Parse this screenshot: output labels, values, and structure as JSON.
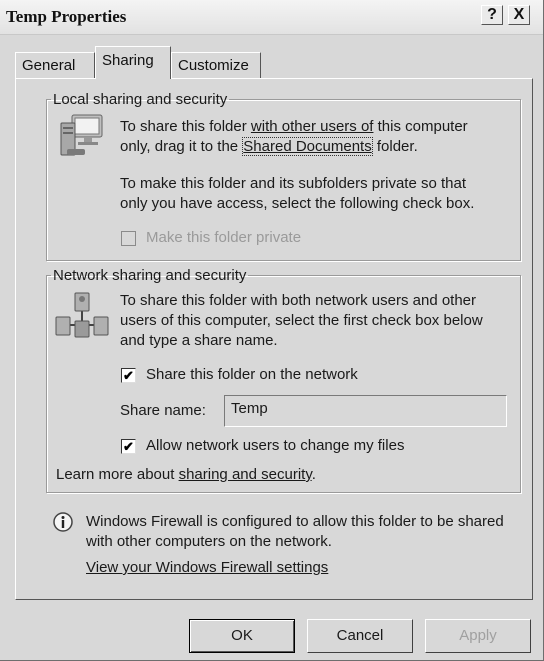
{
  "window": {
    "title": "Temp Properties",
    "help_label": "?",
    "close_label": "X"
  },
  "tabs": [
    {
      "label": "General",
      "active": false
    },
    {
      "label": "Sharing",
      "active": true
    },
    {
      "label": "Customize",
      "active": false
    }
  ],
  "local": {
    "legend": "Local sharing and security",
    "icon": "computer-icon",
    "para1_a": "To share this folder ",
    "para1_link": "with other users of",
    "para1_b": " this computer",
    "para1_c": "only, drag it to the ",
    "para1_link2": "Shared Documents",
    "para1_d": " folder.",
    "para2_line1": "To make this folder and its subfolders private so that",
    "para2_line2": "only you have access, select the following check box.",
    "private_checkbox_label": "Make this folder private",
    "private_checked": false
  },
  "network": {
    "legend": "Network sharing and security",
    "icon": "network-computers-icon",
    "para_line1": "To share this folder with both network users and other",
    "para_line2": "users of this computer, select the first check box below",
    "para_line3": "and type a share name.",
    "share_checkbox_label": "Share this folder on the network",
    "share_checked": true,
    "share_name_label": "Share name:",
    "share_name_value": "Temp",
    "allow_checkbox_label": "Allow network users to change my files",
    "allow_checked": true,
    "learn_more_text": "Learn more about ",
    "learn_more_link": "sharing and security",
    "learn_more_end": "."
  },
  "firewall": {
    "icon": "info-icon",
    "line1": "Windows Firewall is configured to allow this folder to be shared",
    "line2": "with other computers on the network.",
    "link": "View your Windows Firewall settings"
  },
  "buttons": {
    "ok": "OK",
    "cancel": "Cancel",
    "apply": "Apply"
  }
}
